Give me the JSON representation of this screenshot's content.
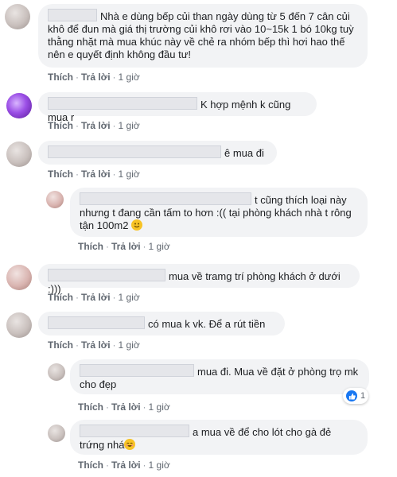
{
  "actions": {
    "like": "Thích",
    "reply": "Trả lời",
    "separator": "·",
    "time": "1 giờ"
  },
  "comments": [
    {
      "text_line1": "Nhà e dùng bếp củi than ngày dùng từ 5 đến 7 cân củi",
      "text_rest": "khô để đun mà giá thị trường củi khô rơi vào 10~15k 1 bó 10kg tuỳ thằng nhặt mà mua khúc này về chẻ ra nhóm bếp thì hơi hao thế nên e quyết định không đầu tư!"
    },
    {
      "text": "K hợp mệnh k cũng mua r"
    },
    {
      "text": "ê mua đi"
    },
    {
      "text_line1": "t cũng thích loại này",
      "text_rest": "nhưng t đang cần tấm to hơn :(( tại phòng khách nhà t rông tận 100m2"
    },
    {
      "text": "mua về tramg trí phòng khách ở dưới :)))"
    },
    {
      "text": "có mua k vk. Để a rút tiền"
    },
    {
      "text_line1": "mua đi. Mua về đặt ở phòng trọ mk",
      "text_rest": "cho đẹp",
      "reaction_count": "1"
    },
    {
      "text_line1": "a mua về để cho lót cho gà đẻ trứng",
      "text_rest": "nhá"
    }
  ],
  "icons": {
    "like": "like-icon",
    "smile": "smiling-emoji-icon",
    "grin": "grinning-emoji-icon"
  }
}
